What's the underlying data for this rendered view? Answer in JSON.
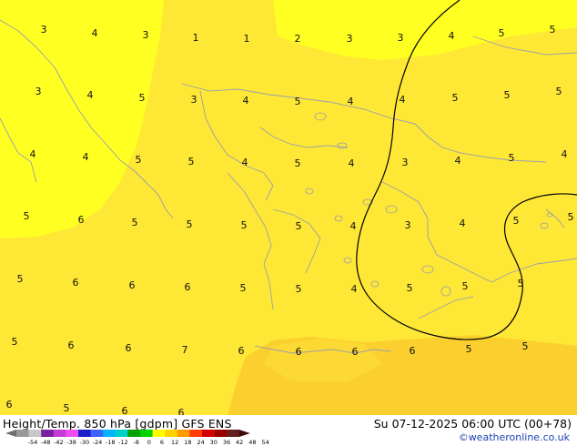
{
  "map": {
    "product": "Height/Temp. 850 hPa [gdpm] GFS ENS",
    "valid_time": "Su 07-12-2025 06:00 UTC (00+78)",
    "credit": "©weatheronline.co.uk",
    "colors": {
      "background": "#ffffff",
      "field_low": "#ffff22",
      "field_mid": "#ffe736",
      "field_high": "#fbd02e",
      "coast": "#9aa0a8",
      "contour": "#000000"
    },
    "labels": [
      "3",
      "4",
      "3",
      "1",
      "1",
      "2",
      "3",
      "3",
      "4",
      "5",
      "5",
      "3",
      "4",
      "5",
      "3",
      "4",
      "5",
      "4",
      "4",
      "5",
      "5",
      "5",
      "4",
      "4",
      "5",
      "5",
      "4",
      "5",
      "4",
      "3",
      "4",
      "5",
      "4",
      "5",
      "6",
      "5",
      "5",
      "5",
      "5",
      "4",
      "3",
      "4",
      "5",
      "5",
      "5",
      "6",
      "6",
      "6",
      "5",
      "5",
      "4",
      "5",
      "5",
      "5",
      "5",
      "6",
      "6",
      "7",
      "6",
      "6",
      "6",
      "6",
      "5",
      "5",
      "6",
      "5",
      "6",
      "6"
    ],
    "scale": {
      "ticks": [
        "-54",
        "-48",
        "-42",
        "-38",
        "-30",
        "-24",
        "-18",
        "-12",
        "-8",
        "0",
        "6",
        "12",
        "18",
        "24",
        "30",
        "36",
        "42",
        "48",
        "54"
      ],
      "colors": [
        "#6e6e6e",
        "#9a9a9a",
        "#c8c8c8",
        "#7a1fa0",
        "#c33cd6",
        "#f04cf0",
        "#1e1ec8",
        "#3c64ff",
        "#00b4ff",
        "#00d2c8",
        "#00a000",
        "#00d200",
        "#ffff00",
        "#ffd200",
        "#ff9b00",
        "#ff3c00",
        "#d20000",
        "#960000",
        "#641e1e",
        "#3c0a0a"
      ]
    }
  }
}
